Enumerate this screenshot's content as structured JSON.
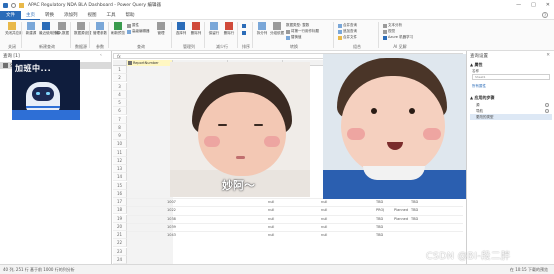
{
  "window": {
    "title": "APAC Regulatory NDA BLA Dashboard - Power Query 编辑器",
    "controls": [
      "—",
      "□",
      "✕"
    ]
  },
  "ribbon_tabs": [
    "文件",
    "主页",
    "转换",
    "添加列",
    "视图",
    "工具",
    "帮助"
  ],
  "ribbon": {
    "close_group": {
      "button": "关闭并应用",
      "label": "关闭"
    },
    "new_query_group": {
      "buttons": [
        "新建源",
        "最近使用的源",
        "输入数据"
      ],
      "label": "新建查询"
    },
    "datasource_group": {
      "button": "数据源设置",
      "label": "数据源"
    },
    "params_group": {
      "button": "管理参数",
      "label": "参数"
    },
    "query_group": {
      "buttons": [
        "刷新预览",
        "管理"
      ],
      "small": [
        "属性",
        "高级编辑器"
      ],
      "label": "查询"
    },
    "manage_columns_group": {
      "buttons": [
        "选择列",
        "删除列"
      ],
      "label": "管理列"
    },
    "reduce_rows_group": {
      "buttons": [
        "保留行",
        "删除行"
      ],
      "label": "减少行"
    },
    "sort_group": {
      "label": "排序"
    },
    "transform_group": {
      "buttons": [
        "拆分列",
        "分组依据"
      ],
      "small": [
        "数据类型: 整数",
        "将第一行用作标题",
        "替换值"
      ],
      "label": "转换"
    },
    "combine_group": {
      "small": [
        "合并查询",
        "追加查询",
        "合并文件"
      ],
      "label": "组合"
    },
    "ai_group": {
      "small": [
        "文本分析",
        "视觉",
        "Azure 机器学习"
      ],
      "label": "AI 见解"
    }
  },
  "queries_pane": {
    "title": "查询 [1]",
    "items": [
      {
        "label": "Sheet1"
      }
    ]
  },
  "sticker": {
    "text": "加班中..."
  },
  "formula_bar": {
    "fx": "fx"
  },
  "grid": {
    "column_header": "ReportNumber",
    "row_numbers": [
      "1",
      "2",
      "3",
      "4",
      "5",
      "6",
      "7",
      "8",
      "9",
      "10",
      "11",
      "12",
      "13",
      "14",
      "15",
      "16",
      "17",
      "18",
      "19",
      "20",
      "21",
      "22",
      "23",
      "24"
    ],
    "rows": [
      {
        "id": "1007",
        "c2": "null",
        "c3": "null",
        "c4": "TBD",
        "c5": ""
      },
      {
        "id": "1022",
        "c2": "null",
        "c3": "null",
        "c4": "PROJ",
        "c5": "Planned"
      },
      {
        "id": "1038",
        "c2": "null",
        "c3": "null",
        "c4": "TBD",
        "c5": "Planned"
      },
      {
        "id": "1039",
        "c2": "null",
        "c3": "null",
        "c4": "TBD",
        "c5": ""
      },
      {
        "id": "1043",
        "c2": "null",
        "c3": "null",
        "c4": "TBD",
        "c5": ""
      }
    ],
    "right_flags": [
      "TBD",
      "TBD",
      "TBD"
    ]
  },
  "photo1": {
    "caption": "妙阿～"
  },
  "settings_pane": {
    "title": "查询设置",
    "properties_header": "▲ 属性",
    "name_label": "名称",
    "name_value": "Sheet1",
    "all_properties": "所有属性",
    "applied_steps_header": "▲ 应用的步骤",
    "steps": [
      "源",
      "导航",
      "更改的类型"
    ],
    "selected_step": 2
  },
  "status": {
    "columns": "40 列, 251 行",
    "profile": "基于前 1000 行的列分析",
    "download": "在 10:15 下载的预览"
  },
  "watermark": "CSDN @BI-段二胖"
}
